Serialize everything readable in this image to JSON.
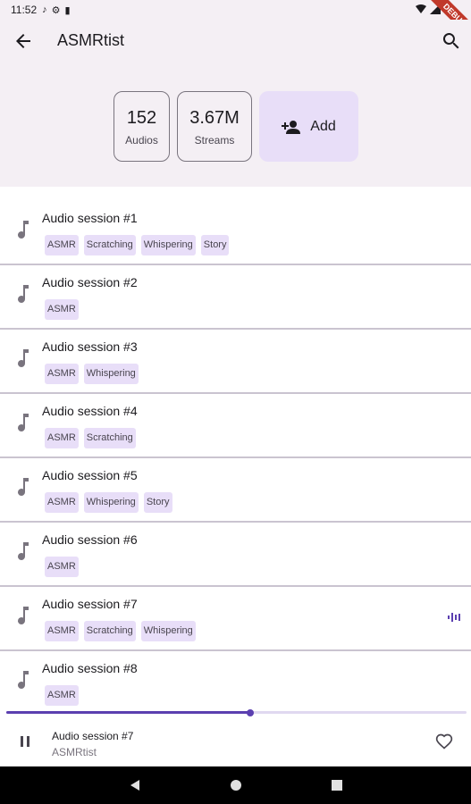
{
  "status_bar": {
    "time": "11:52",
    "debug_label": "DEBUG"
  },
  "app_bar": {
    "title": "ASMRtist"
  },
  "stats": {
    "audios_value": "152",
    "audios_label": "Audios",
    "streams_value": "3.67M",
    "streams_label": "Streams",
    "add_label": "Add"
  },
  "sessions": [
    {
      "title": "Audio session #1",
      "tags": [
        "ASMR",
        "Scratching",
        "Whispering",
        "Story"
      ],
      "playing": false
    },
    {
      "title": "Audio session #2",
      "tags": [
        "ASMR"
      ],
      "playing": false
    },
    {
      "title": "Audio session #3",
      "tags": [
        "ASMR",
        "Whispering"
      ],
      "playing": false
    },
    {
      "title": "Audio session #4",
      "tags": [
        "ASMR",
        "Scratching"
      ],
      "playing": false
    },
    {
      "title": "Audio session #5",
      "tags": [
        "ASMR",
        "Whispering",
        "Story"
      ],
      "playing": false
    },
    {
      "title": "Audio session #6",
      "tags": [
        "ASMR"
      ],
      "playing": false
    },
    {
      "title": "Audio session #7",
      "tags": [
        "ASMR",
        "Scratching",
        "Whispering"
      ],
      "playing": true
    },
    {
      "title": "Audio session #8",
      "tags": [
        "ASMR"
      ],
      "playing": false
    }
  ],
  "player": {
    "title": "Audio session #7",
    "artist": "ASMRtist",
    "progress": 0.53
  },
  "colors": {
    "accent": "#5b3fb0",
    "chip_bg": "#e8def8",
    "surface": "#f4eff4"
  }
}
